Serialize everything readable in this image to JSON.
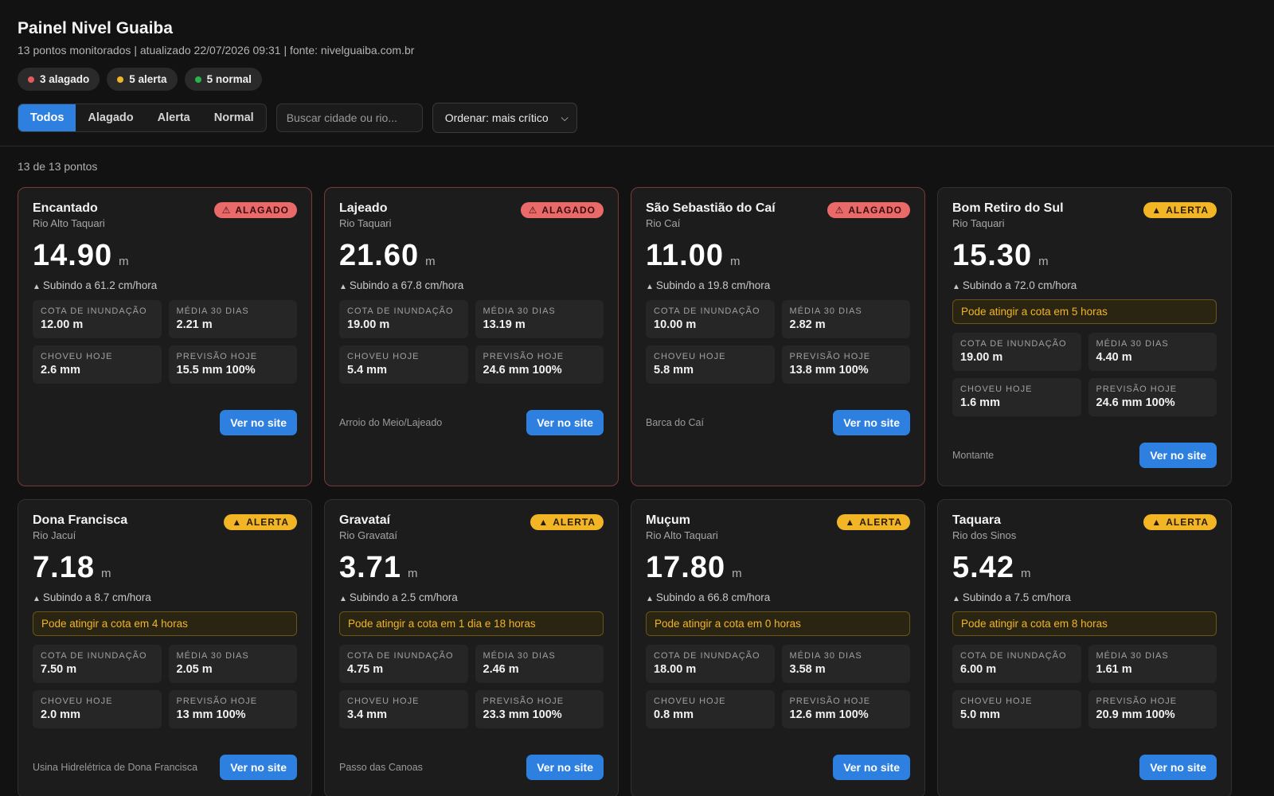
{
  "header": {
    "title": "Painel Nivel Guaiba",
    "subtitle": "13 pontos monitorados | atualizado 22/07/2026 09:31 | fonte: nivelguaiba.com.br"
  },
  "summary": [
    {
      "label": "3 alagado",
      "color": "#e35b5b"
    },
    {
      "label": "5 alerta",
      "color": "#f0b429"
    },
    {
      "label": "5 normal",
      "color": "#2bb24c"
    }
  ],
  "filters": {
    "tabs": [
      "Todos",
      "Alagado",
      "Alerta",
      "Normal"
    ],
    "active": "Todos",
    "search_placeholder": "Buscar cidade ou rio...",
    "sort_label": "Ordenar: mais crítico"
  },
  "count_text": "13 de 13 pontos",
  "labels": {
    "cota": "COTA DE INUNDAÇÃO",
    "media": "MÉDIA 30 DIAS",
    "choveu": "CHOVEU HOJE",
    "previsao": "PREVISÃO HOJE",
    "button": "Ver no site",
    "unit": "m",
    "badge_flood": "ALAGADO",
    "badge_alert": "ALERTA"
  },
  "cards": [
    {
      "city": "Encantado",
      "river": "Rio Alto Taquari",
      "status": "flood",
      "level": "14.90",
      "trend": "Subindo a 61.2 cm/hora",
      "warning": "",
      "cota": "12.00 m",
      "media": "2.21 m",
      "choveu": "2.6 mm",
      "previsao": "15.5 mm 100%",
      "station": ""
    },
    {
      "city": "Lajeado",
      "river": "Rio Taquari",
      "status": "flood",
      "level": "21.60",
      "trend": "Subindo a 67.8 cm/hora",
      "warning": "",
      "cota": "19.00 m",
      "media": "13.19 m",
      "choveu": "5.4 mm",
      "previsao": "24.6 mm 100%",
      "station": "Arroio do Meio/Lajeado"
    },
    {
      "city": "São Sebastião do Caí",
      "river": "Rio Caí",
      "status": "flood",
      "level": "11.00",
      "trend": "Subindo a 19.8 cm/hora",
      "warning": "",
      "cota": "10.00 m",
      "media": "2.82 m",
      "choveu": "5.8 mm",
      "previsao": "13.8 mm 100%",
      "station": "Barca do Caí"
    },
    {
      "city": "Bom Retiro do Sul",
      "river": "Rio Taquari",
      "status": "alert",
      "level": "15.30",
      "trend": "Subindo a 72.0 cm/hora",
      "warning": "Pode atingir a cota em 5 horas",
      "cota": "19.00 m",
      "media": "4.40 m",
      "choveu": "1.6 mm",
      "previsao": "24.6 mm 100%",
      "station": "Montante"
    },
    {
      "city": "Dona Francisca",
      "river": "Rio Jacuí",
      "status": "alert",
      "level": "7.18",
      "trend": "Subindo a 8.7 cm/hora",
      "warning": "Pode atingir a cota em 4 horas",
      "cota": "7.50 m",
      "media": "2.05 m",
      "choveu": "2.0 mm",
      "previsao": "13 mm 100%",
      "station": "Usina Hidrelétrica de Dona Francisca"
    },
    {
      "city": "Gravataí",
      "river": "Rio Gravataí",
      "status": "alert",
      "level": "3.71",
      "trend": "Subindo a 2.5 cm/hora",
      "warning": "Pode atingir a cota em 1 dia e 18 horas",
      "cota": "4.75 m",
      "media": "2.46 m",
      "choveu": "3.4 mm",
      "previsao": "23.3 mm 100%",
      "station": "Passo das Canoas"
    },
    {
      "city": "Muçum",
      "river": "Rio Alto Taquari",
      "status": "alert",
      "level": "17.80",
      "trend": "Subindo a 66.8 cm/hora",
      "warning": "Pode atingir a cota em 0 horas",
      "cota": "18.00 m",
      "media": "3.58 m",
      "choveu": "0.8 mm",
      "previsao": "12.6 mm 100%",
      "station": ""
    },
    {
      "city": "Taquara",
      "river": "Rio dos Sinos",
      "status": "alert",
      "level": "5.42",
      "trend": "Subindo a 7.5 cm/hora",
      "warning": "Pode atingir a cota em 8 horas",
      "cota": "6.00 m",
      "media": "1.61 m",
      "choveu": "5.0 mm",
      "previsao": "20.9 mm 100%",
      "station": ""
    }
  ]
}
